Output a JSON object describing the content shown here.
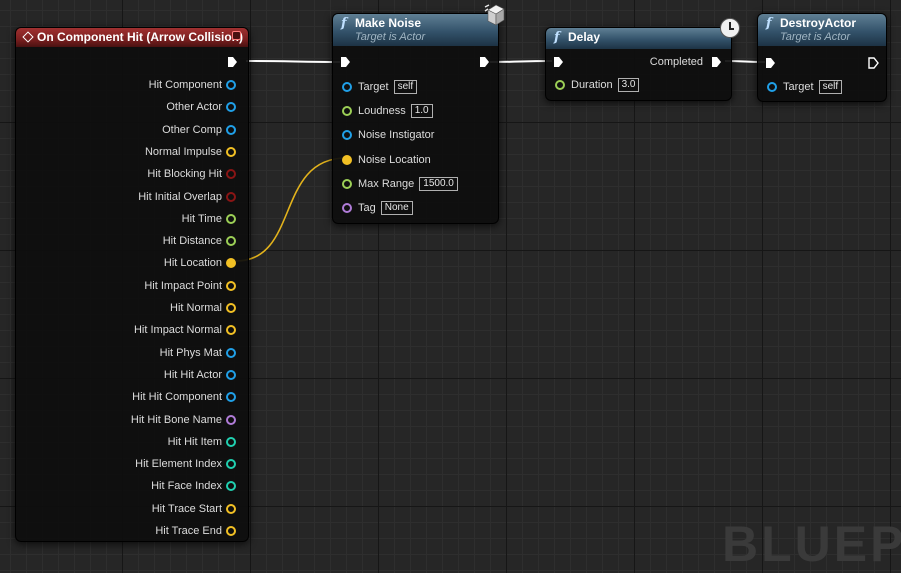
{
  "watermark": "BLUEPR",
  "colors": {
    "exec": "#ffffff",
    "object": "#20a0e8",
    "float": "#9ccf56",
    "vector": "#f2c024",
    "bool": "#8a1515",
    "struct": "#1a58b0",
    "name": "#b07cd8",
    "int": "#20d0b0",
    "wire_vector": "#e3b31c"
  },
  "event_node": {
    "title": "On Component Hit (Arrow Collision)",
    "icon": "event-diamond-icon",
    "pins": [
      {
        "label": "Hit Component",
        "type": "object"
      },
      {
        "label": "Other Actor",
        "type": "object"
      },
      {
        "label": "Other Comp",
        "type": "object"
      },
      {
        "label": "Normal Impulse",
        "type": "vector"
      },
      {
        "label": "Hit Blocking Hit",
        "type": "bool"
      },
      {
        "label": "Hit Initial Overlap",
        "type": "bool"
      },
      {
        "label": "Hit Time",
        "type": "float"
      },
      {
        "label": "Hit Distance",
        "type": "float"
      },
      {
        "label": "Hit Location",
        "type": "vector",
        "connected": true
      },
      {
        "label": "Hit Impact Point",
        "type": "vector"
      },
      {
        "label": "Hit Normal",
        "type": "vector"
      },
      {
        "label": "Hit Impact Normal",
        "type": "vector"
      },
      {
        "label": "Hit Phys Mat",
        "type": "object"
      },
      {
        "label": "Hit Hit Actor",
        "type": "object"
      },
      {
        "label": "Hit Hit Component",
        "type": "object"
      },
      {
        "label": "Hit Hit Bone Name",
        "type": "name"
      },
      {
        "label": "Hit Hit Item",
        "type": "int"
      },
      {
        "label": "Hit Element Index",
        "type": "int"
      },
      {
        "label": "Hit Face Index",
        "type": "int"
      },
      {
        "label": "Hit Trace Start",
        "type": "vector"
      },
      {
        "label": "Hit Trace End",
        "type": "vector"
      }
    ]
  },
  "make_noise": {
    "title": "Make Noise",
    "subtitle": "Target is Actor",
    "corner_icon": "replication-cube-icon",
    "pins": [
      {
        "label": "Target",
        "type": "object",
        "value": "self"
      },
      {
        "label": "Loudness",
        "type": "float",
        "value": "1.0"
      },
      {
        "label": "Noise Instigator",
        "type": "object"
      },
      {
        "label": "Noise Location",
        "type": "vector",
        "connected": true
      },
      {
        "label": "Max Range",
        "type": "float",
        "value": "1500.0"
      },
      {
        "label": "Tag",
        "type": "name",
        "value": "None"
      }
    ]
  },
  "delay": {
    "title": "Delay",
    "corner_icon": "clock-icon",
    "completed_label": "Completed",
    "pins": [
      {
        "label": "Duration",
        "type": "float",
        "value": "3.0"
      }
    ]
  },
  "destroy_actor": {
    "title": "DestroyActor",
    "subtitle": "Target is Actor",
    "pins": [
      {
        "label": "Target",
        "type": "object",
        "value": "self"
      }
    ]
  }
}
